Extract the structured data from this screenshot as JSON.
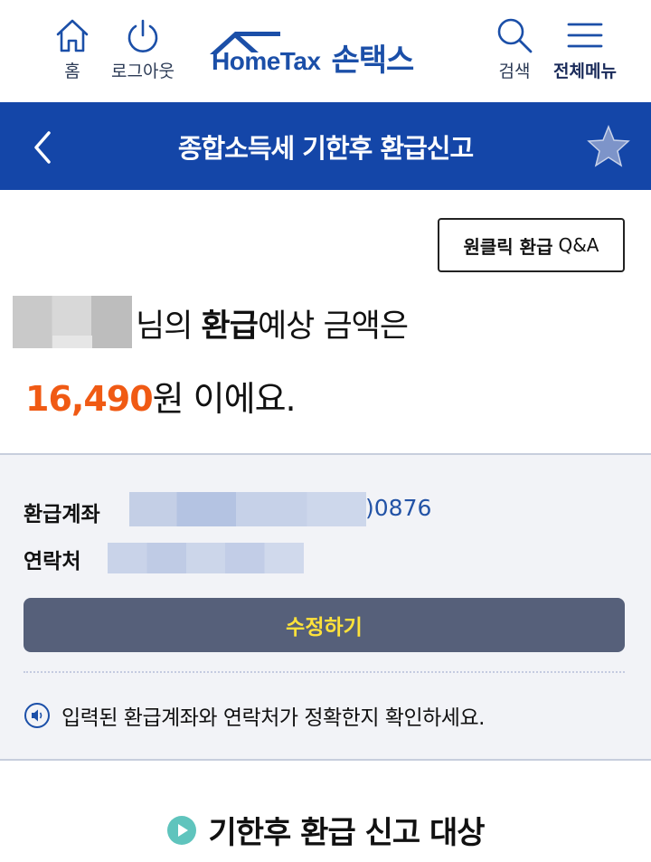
{
  "header": {
    "home_label": "홈",
    "logout_label": "로그아웃",
    "logo_text": "HomeTax",
    "logo_son": "손택스",
    "search_label": "검색",
    "menu_label": "전체메뉴"
  },
  "titlebar": {
    "title": "종합소득세 기한후 환급신고"
  },
  "qa_button": {
    "bold": "원클릭 환급",
    "rest": "Q&A"
  },
  "message": {
    "suffix_1": "님의 ",
    "bold_1": "환급",
    "suffix_2": "예상 금액은",
    "amount": "16,490",
    "amount_suffix": "원 이에요."
  },
  "info": {
    "account_label": "환급계좌",
    "account_tail": ")0876",
    "contact_label": "연락처",
    "edit_button": "수정하기",
    "notice": "입력된 환급계좌와 연락처가 정확한지 확인하세요."
  },
  "section": {
    "title": "기한후 환급 신고 대상"
  },
  "colors": {
    "brand_blue": "#1446a8",
    "amount_orange": "#f05a14",
    "edit_button_bg": "#56607a",
    "edit_button_text": "#ffe23a",
    "section_icon": "#5fc4bd"
  },
  "icons": [
    "home-icon",
    "power-icon",
    "logo-house-icon",
    "search-icon",
    "menu-icon",
    "back-chevron-icon",
    "star-icon",
    "speaker-icon",
    "play-circle-icon"
  ]
}
